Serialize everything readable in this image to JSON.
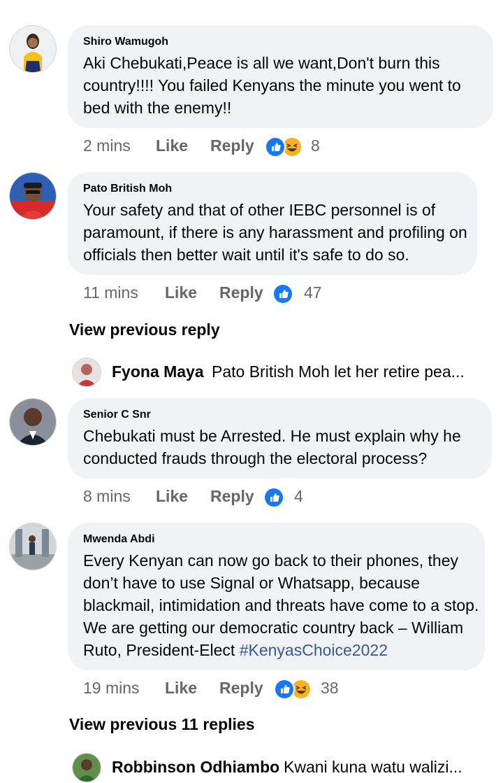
{
  "colors": {
    "bubble": "#f0f2f5",
    "meta_text": "#65676b",
    "like_blue": "#1877f2",
    "haha_yellow": "#f7b125",
    "hashtag": "#385898"
  },
  "comments": [
    {
      "author": "Shiro Wamugoh",
      "text": "Aki Chebukati,Peace is all we want,Don't burn this country!!!! You failed Kenyans the minute you went to bed with the enemy!!",
      "time": "2 mins",
      "like": "Like",
      "reply": "Reply",
      "reactions": [
        "like-icon",
        "haha-icon"
      ],
      "reaction_count": "8"
    },
    {
      "author": "Pato British Moh",
      "text": "Your safety and that of other IEBC personnel is of paramount, if there is any harassment and profiling on officials then better wait until it's safe to do so.",
      "time": "11 mins",
      "like": "Like",
      "reply": "Reply",
      "reactions": [
        "like-icon"
      ],
      "reaction_count": "47"
    },
    {
      "author": "Senior C Snr",
      "text": "Chebukati must be Arrested. He must explain why he conducted frauds through the electoral process?",
      "time": "8 mins",
      "like": "Like",
      "reply": "Reply",
      "reactions": [
        "like-icon"
      ],
      "reaction_count": "4"
    },
    {
      "author": "Mwenda Abdi",
      "text": "Every Kenyan can now go back to their phones, they don’t have to use Signal or Whatsapp, because blackmail, intimidation and threats have come to a stop. We are getting our democratic country back – William Ruto, President-Elect",
      "hashtag": "#KenyasChoice2022",
      "time": "19 mins",
      "like": "Like",
      "reply": "Reply",
      "reactions": [
        "like-icon",
        "haha-icon"
      ],
      "reaction_count": "38"
    }
  ],
  "threads": [
    {
      "view_previous": "View previous reply",
      "reply_author": "Fyona Maya",
      "reply_preview": "Pato British Moh let her retire pea..."
    },
    {
      "view_previous": "View previous 11 replies",
      "reply_author": "Robbinson Odhiambo",
      "reply_preview": "Kwani kuna watu walizi..."
    }
  ]
}
